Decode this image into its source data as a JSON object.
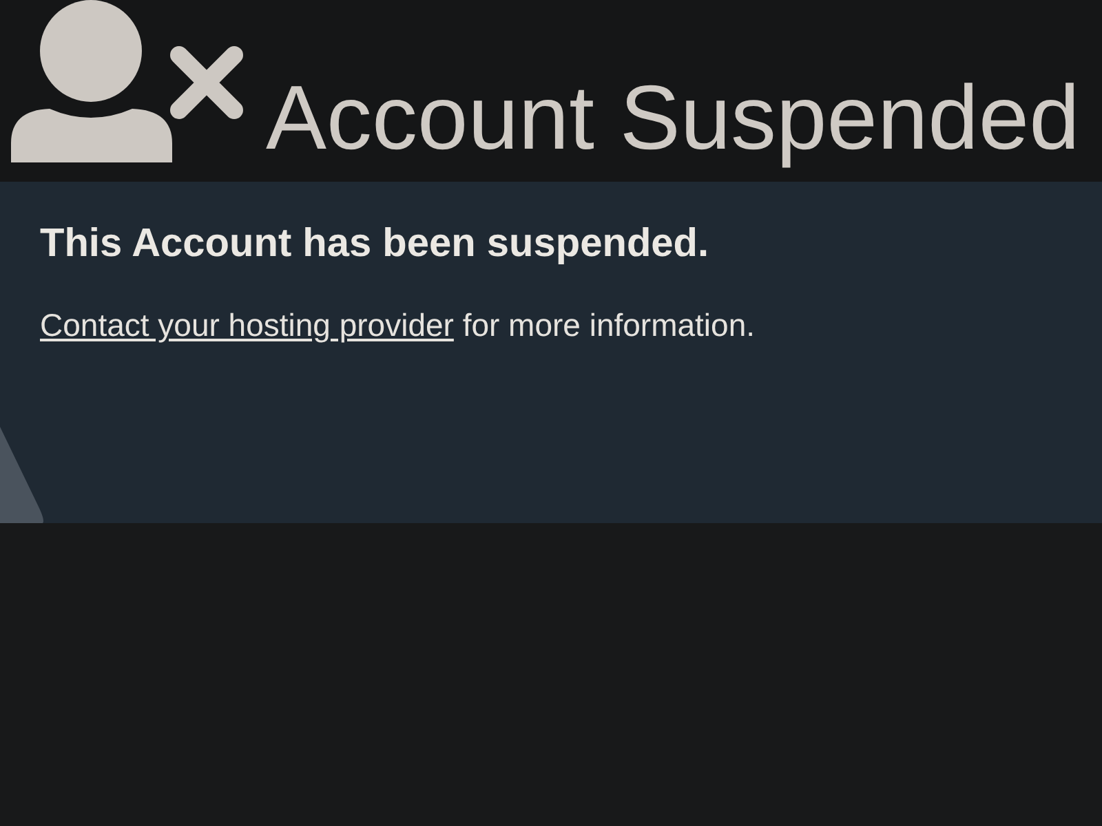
{
  "header": {
    "title": "Account Suspended"
  },
  "message": {
    "heading": "This Account has been suspended.",
    "link": "Contact your hosting provider",
    "text": "for more information."
  }
}
